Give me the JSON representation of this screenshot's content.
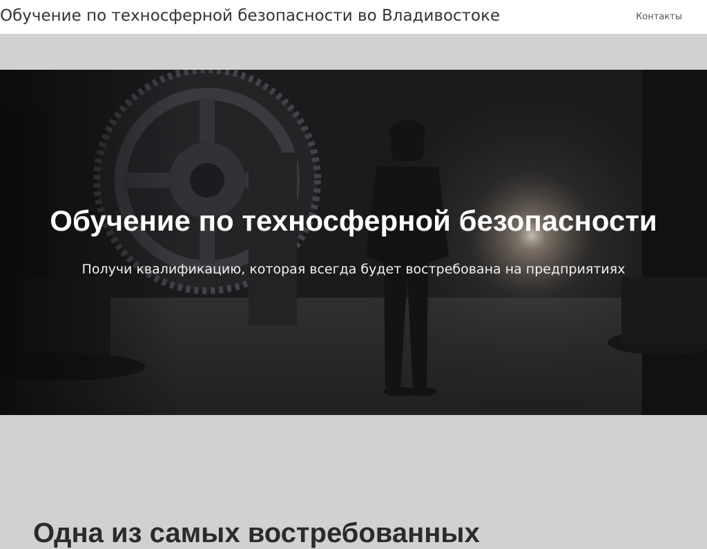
{
  "header": {
    "site_title": "Обучение по техносферной безопасности во Владивостоке",
    "nav": {
      "contacts_label": "Контакты"
    }
  },
  "hero": {
    "title": "Обучение по техносферной безопасности",
    "subtitle": "Получи квалификацию, которая всегда будет востребована на предприятиях",
    "background_image": "industrial-worker-hardhat-gears",
    "overlay_color": "#000000"
  },
  "section": {
    "heading": "Одна из самых востребованных"
  },
  "colors": {
    "page_background": "#d1d1d1",
    "header_background": "#ffffff",
    "hero_text": "#ffffff"
  }
}
